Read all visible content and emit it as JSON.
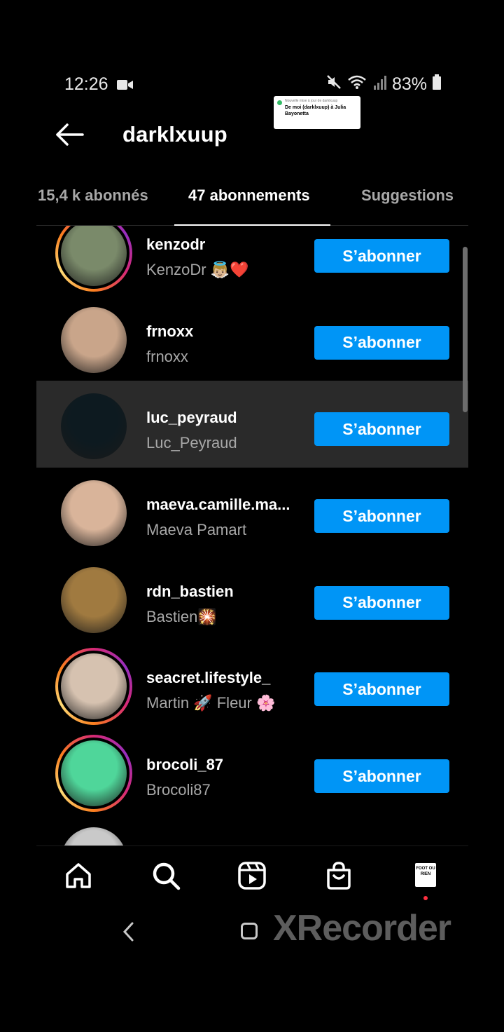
{
  "status_bar": {
    "time": "12:26",
    "battery": "83%"
  },
  "notification": {
    "small_text": "Nouvelle mise à jour de darklxuup",
    "message": "De moi (darklxuup) à Julia Bayonetta"
  },
  "header": {
    "title": "darklxuup"
  },
  "tabs": [
    {
      "label": "15,4 k abonnés"
    },
    {
      "label": "47 abonnements",
      "active": true
    },
    {
      "label": "Suggestions"
    }
  ],
  "follow_label": "S’abonner",
  "users": [
    {
      "username": "kenzodr",
      "fullname": "KenzoDr 👼🏼❤️",
      "story_ring": true,
      "avatar_color": "#7a8a6a"
    },
    {
      "username": "frnoxx",
      "fullname": "frnoxx",
      "story_ring": false,
      "avatar_color": "#c9a58a"
    },
    {
      "username": "luc_peyraud",
      "fullname": "Luc_Peyraud",
      "story_ring": false,
      "avatar_color": "#0d1a20",
      "highlighted": true
    },
    {
      "username": "maeva.camille.ma...",
      "fullname": "Maeva Pamart",
      "story_ring": false,
      "avatar_color": "#d9b49a"
    },
    {
      "username": "rdn_bastien",
      "fullname": "Bastien🎇",
      "story_ring": false,
      "avatar_color": "#a07a40"
    },
    {
      "username": "seacret.lifestyle_",
      "fullname": "Martin 🚀 Fleur 🌸",
      "story_ring": true,
      "avatar_color": "#d6c2b0"
    },
    {
      "username": "brocoli_87",
      "fullname": "Brocoli87",
      "story_ring": true,
      "avatar_color": "#4fd69a"
    },
    {
      "username": "",
      "fullname": "",
      "story_ring": false,
      "avatar_color": "#c9c9c9"
    }
  ],
  "bottom_nav": {
    "items": [
      "home-icon",
      "search-icon",
      "reels-icon",
      "shop-icon"
    ],
    "profile_text": "FOOT OU RIEN"
  },
  "watermark": "XRecorder"
}
